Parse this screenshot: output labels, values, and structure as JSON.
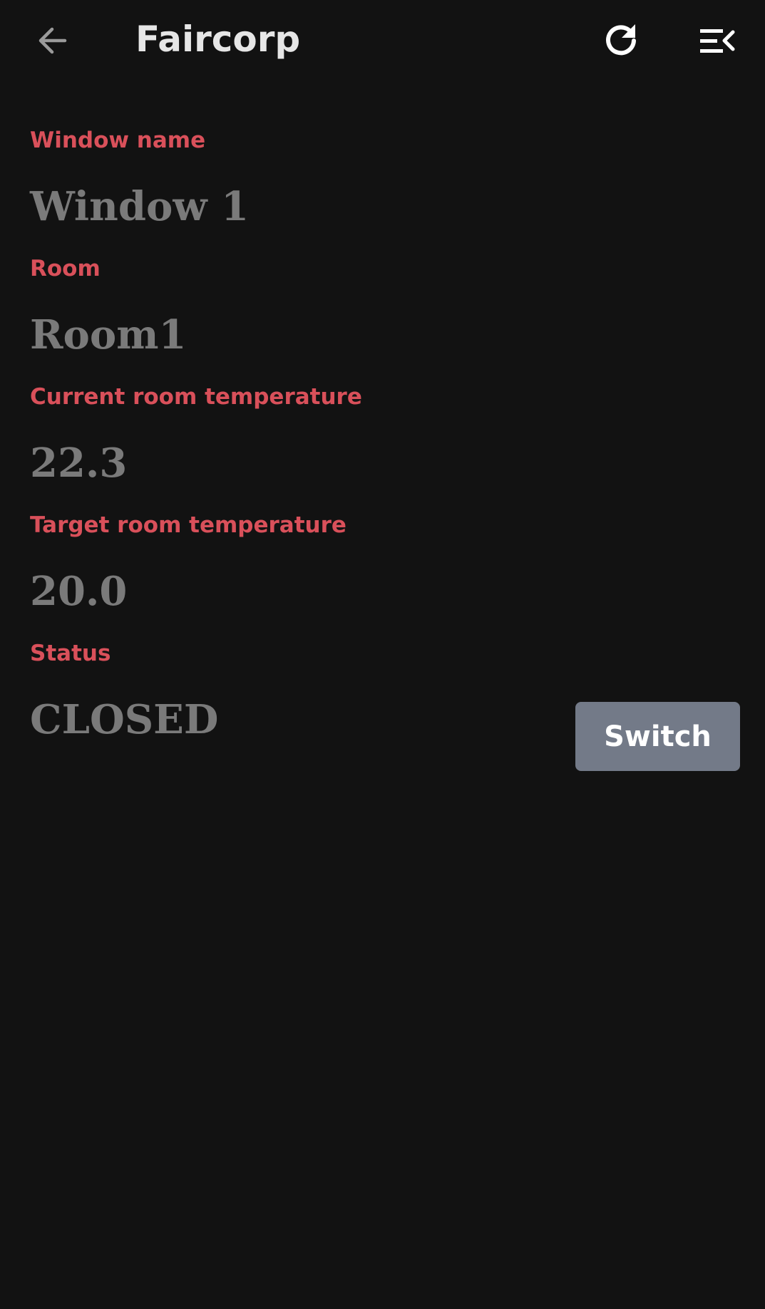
{
  "app_bar": {
    "title": "Faircorp",
    "back_icon": "arrow-back-icon",
    "refresh_icon": "refresh-icon",
    "menu_icon": "menu-open-icon"
  },
  "window_detail": {
    "name_label": "Window name",
    "name_value": "Window 1",
    "room_label": "Room",
    "room_value": "Room1",
    "current_temp_label": "Current room temperature",
    "current_temp_value": "22.3",
    "target_temp_label": "Target room temperature",
    "target_temp_value": "20.0",
    "status_label": "Status",
    "status_value": "CLOSED",
    "switch_button_label": "Switch"
  },
  "colors": {
    "background": "#121212",
    "label": "#d9505a",
    "value": "#7a7a7a",
    "title": "#e6e6e6",
    "button": "#737a88"
  }
}
